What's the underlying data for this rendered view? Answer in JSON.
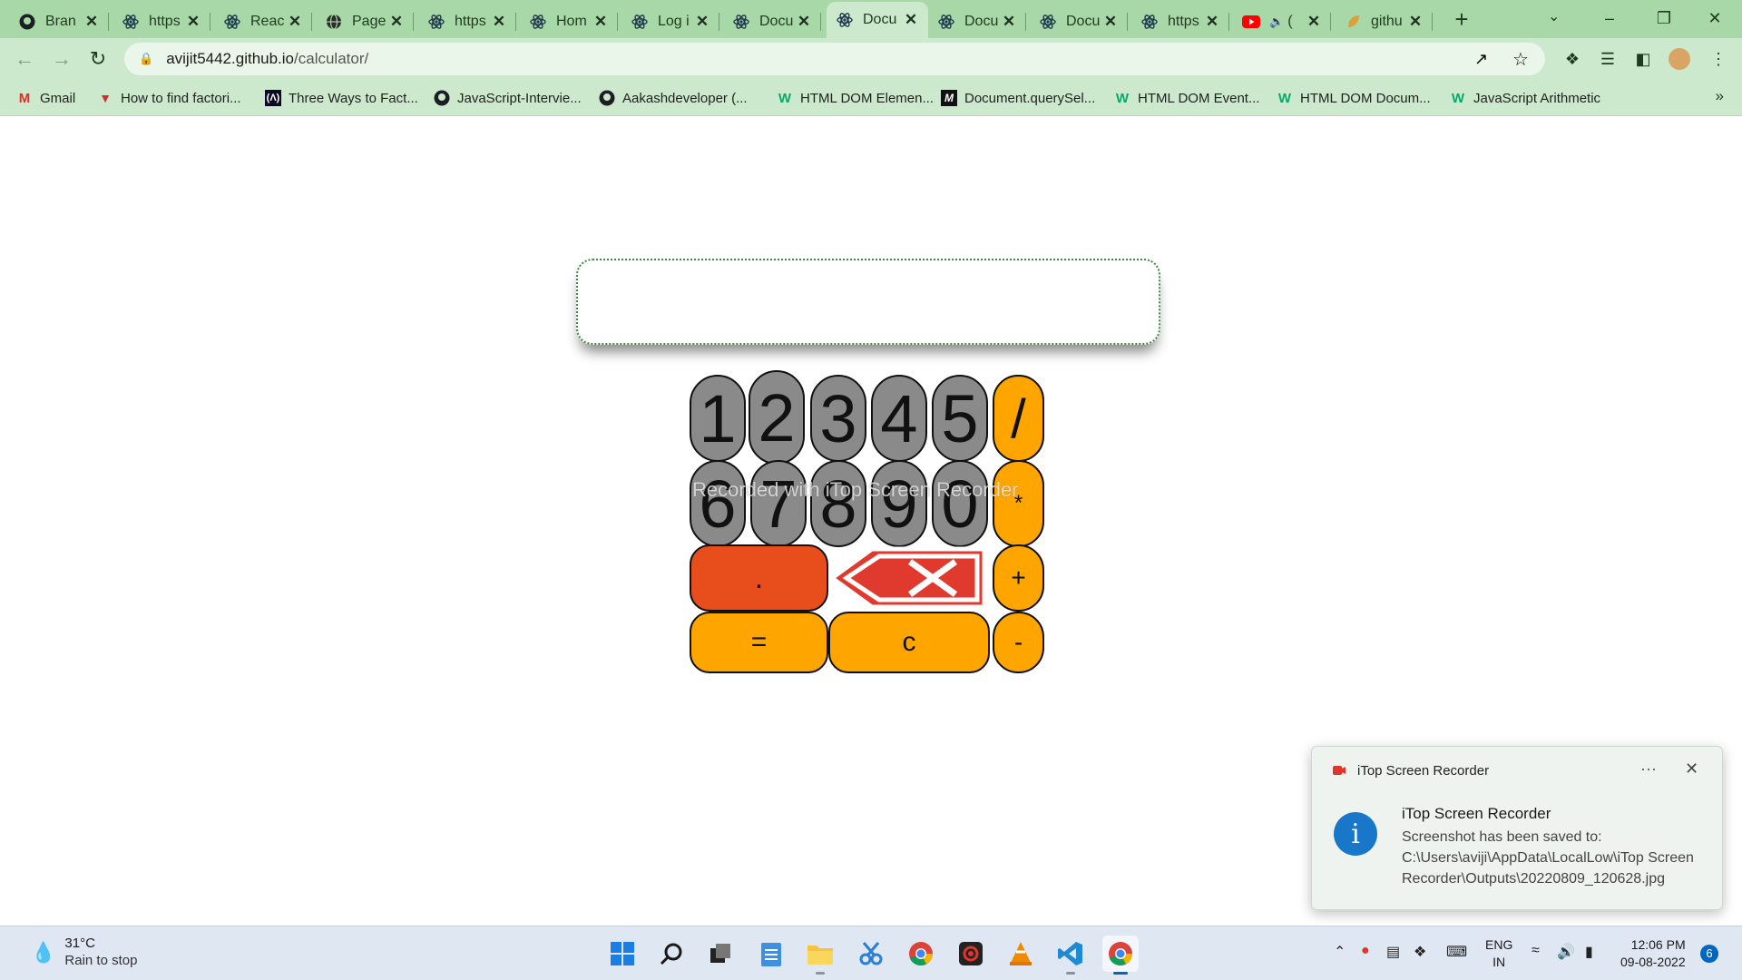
{
  "tabs": [
    {
      "title": "Bran",
      "icon": "github-icon"
    },
    {
      "title": "https",
      "icon": "react-icon"
    },
    {
      "title": "Reac",
      "icon": "react-icon"
    },
    {
      "title": "Page",
      "icon": "globe-icon"
    },
    {
      "title": "https",
      "icon": "react-icon"
    },
    {
      "title": "Hom",
      "icon": "react-icon"
    },
    {
      "title": "Log i",
      "icon": "react-icon"
    },
    {
      "title": "Docu",
      "icon": "react-icon"
    },
    {
      "title": "Docu",
      "icon": "react-icon",
      "active": true
    },
    {
      "title": "Docu",
      "icon": "react-icon"
    },
    {
      "title": "Docu",
      "icon": "react-icon"
    },
    {
      "title": "https",
      "icon": "react-icon"
    },
    {
      "title": "(",
      "icon": "youtube-icon"
    },
    {
      "title": "githu",
      "icon": "leaf-icon"
    }
  ],
  "address_bar": {
    "host": "avijit5442.github.io",
    "path": "/calculator/"
  },
  "bookmarks": [
    {
      "label": "Gmail",
      "icon": "gmail-icon"
    },
    {
      "label": "How to find factori...",
      "icon": "triangle-icon"
    },
    {
      "label": "Three Ways to Fact...",
      "icon": "freecodecamp-icon"
    },
    {
      "label": "JavaScript-Intervie...",
      "icon": "github-icon"
    },
    {
      "label": "Aakashdeveloper (...",
      "icon": "github-icon"
    },
    {
      "label": "HTML DOM Elemen...",
      "icon": "w3schools-icon"
    },
    {
      "label": "Document.querySel...",
      "icon": "mdn-icon"
    },
    {
      "label": "HTML DOM Event...",
      "icon": "w3schools-icon"
    },
    {
      "label": "HTML DOM Docum...",
      "icon": "w3schools-icon"
    },
    {
      "label": "JavaScript Arithmetic",
      "icon": "w3schools-icon"
    }
  ],
  "calculator": {
    "display_value": "",
    "row1": [
      "1",
      "2",
      "3",
      "4",
      "5"
    ],
    "row2": [
      "6",
      "7",
      "8",
      "9",
      "0"
    ],
    "ops": {
      "divide": "/",
      "multiply": "*",
      "add": "+",
      "subtract": "-"
    },
    "dot": ".",
    "equals": "=",
    "clear": "c",
    "colors": {
      "digit": "#8a8a8a",
      "operator": "#ffa500",
      "dot": "#e84e1b",
      "backspace": "#e03a2e"
    }
  },
  "watermark": "Recorded with iTop Screen Recorder",
  "notification": {
    "app_name": "iTop Screen Recorder",
    "title": "iTop Screen Recorder",
    "body": "Screenshot has been saved to: C:\\Users\\aviji\\AppData\\LocalLow\\iTop Screen Recorder\\Outputs\\20220809_120628.jpg"
  },
  "taskbar": {
    "weather_temp": "31°C",
    "weather_condition": "Rain to stop",
    "language": [
      "ENG",
      "IN"
    ],
    "time": "12:06 PM",
    "date": "09-08-2022",
    "notification_count": "6"
  }
}
